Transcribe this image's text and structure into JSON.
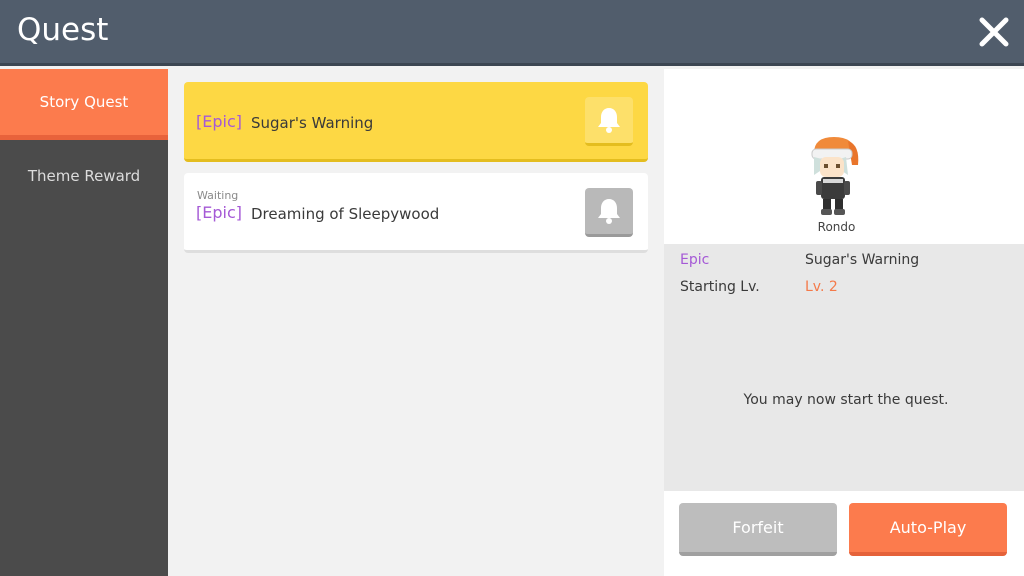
{
  "header": {
    "title": "Quest",
    "close_icon": "close-icon"
  },
  "sidebar": {
    "items": [
      {
        "label": "Story Quest",
        "active": true
      },
      {
        "label": "Theme Reward",
        "active": false
      }
    ]
  },
  "quests": [
    {
      "status": "",
      "tag": "[Epic]",
      "name": "Sugar's Warning",
      "selected": true,
      "icon": "bell-icon"
    },
    {
      "status": "Waiting",
      "tag": "[Epic]",
      "name": "Dreaming of Sleepywood",
      "selected": false,
      "icon": "bell-icon"
    }
  ],
  "detail": {
    "npc_name": "Rondo",
    "info": [
      {
        "key": "Epic",
        "value": "Sugar's Warning"
      },
      {
        "key": "Starting Lv.",
        "value": "Lv. 2"
      }
    ],
    "message": "You may now start the quest.",
    "buttons": {
      "forfeit": "Forfeit",
      "auto_play": "Auto-Play"
    }
  },
  "colors": {
    "header": "#515d6c",
    "accent_orange": "#fc7b4d",
    "selected_yellow": "#fdd844",
    "epic_purple": "#a559d6",
    "level_orange": "#f47a4a"
  }
}
